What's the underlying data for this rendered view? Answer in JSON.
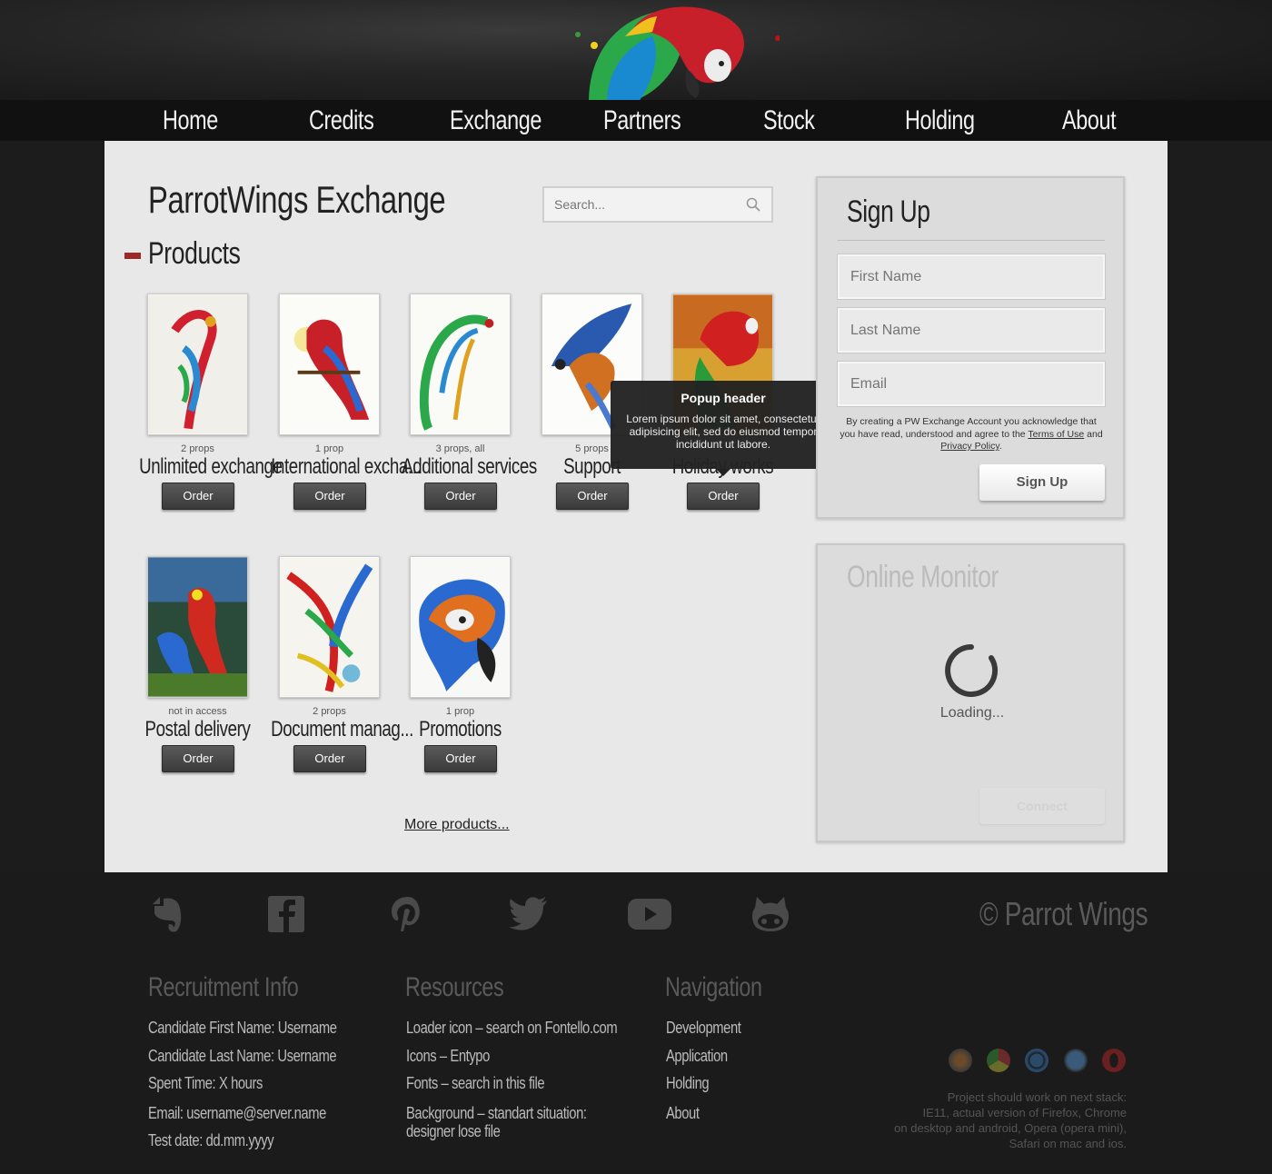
{
  "nav": [
    "Home",
    "Credits",
    "Exchange",
    "Partners",
    "Stock",
    "Holding",
    "About"
  ],
  "site_title": "ParrotWings Exchange",
  "search": {
    "placeholder": "Search..."
  },
  "products_title": "Products",
  "products": [
    {
      "meta": "2 props",
      "name": "Unlimited exchange",
      "order": "Order"
    },
    {
      "meta": "1 prop",
      "name": "International excha...",
      "order": "Order"
    },
    {
      "meta": "3 props, all",
      "name": "Additional services",
      "order": "Order"
    },
    {
      "meta": "5 props",
      "name": "Support",
      "order": "Order"
    },
    {
      "meta": "",
      "name": "Holiday works",
      "order": "Order"
    },
    {
      "meta": "not in access",
      "name": "Postal delivery",
      "order": "Order"
    },
    {
      "meta": "2 props",
      "name": "Document manag...",
      "order": "Order"
    },
    {
      "meta": "1 prop",
      "name": "Promotions",
      "order": "Order"
    }
  ],
  "more_products": "More products...",
  "popup": {
    "header": "Popup header",
    "body": "Lorem ipsum dolor sit amet, consectetur adipisicing elit, sed do eiusmod tempor incididunt ut labore."
  },
  "signup": {
    "title": "Sign Up",
    "first_name": "First Name",
    "last_name": "Last Name",
    "email": "Email",
    "terms_before": "By creating a PW Exchange Account you acknowledge that you have read, understood and agree to the ",
    "terms_link": "Terms of Use",
    "terms_mid": " and ",
    "privacy_link": "Privacy Policy",
    "terms_end": ".",
    "button": "Sign Up"
  },
  "monitor": {
    "title": "Online Monitor",
    "loading": "Loading...",
    "button": "Connect"
  },
  "footer": {
    "social_icons": [
      "evernote-icon",
      "facebook-icon",
      "pinterest-icon",
      "twitter-icon",
      "youtube-icon",
      "github-icon"
    ],
    "copyright": "© Parrot Wings",
    "recruitment": {
      "title": "Recruitment Info",
      "lines": [
        "Candidate First Name: Username",
        "Candidate Last Name: Username",
        "Spent Time: X hours",
        "Email: username@server.name",
        "Test date: dd.mm.yyyy"
      ]
    },
    "resources": {
      "title": "Resources",
      "lines": [
        "Loader icon – search on Fontello.com",
        "Icons – Entypo",
        "Fonts – search in this file",
        "Background – standart situation:",
        "designer lose file"
      ]
    },
    "navigation": {
      "title": "Navigation",
      "lines": [
        "Development",
        "Application",
        "Holding",
        "About"
      ]
    },
    "browsers": [
      "firefox-icon",
      "chrome-icon",
      "ie-icon",
      "safari-icon",
      "opera-icon"
    ],
    "stack_note": [
      "Project should work on next stack:",
      "IE11, actual version of Firefox, Chrome",
      "on desktop and android, Opera (opera mini),",
      "Safari on mac and ios."
    ]
  },
  "colors": {
    "accent": "#9a2b2b",
    "nav_bg": "#111111",
    "main_bg": "#e8e8e8",
    "footer_bg": "#1b1b1b"
  }
}
